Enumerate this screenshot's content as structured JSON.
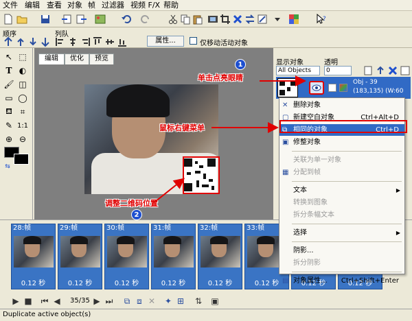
{
  "menu": [
    "文件",
    "编辑",
    "查看",
    "对象",
    "帧",
    "过滤器",
    "视频 F/X",
    "帮助"
  ],
  "toolbar2": {
    "order_label": "顺序",
    "queue_label": "列队",
    "properties_button": "属性...",
    "move_only_active_label": "仅移动活动对象"
  },
  "tabs": [
    "编辑",
    "优化",
    "预览"
  ],
  "objects": {
    "display_label": "显示对象",
    "display_value": "All Objects",
    "opacity_label": "透明",
    "opacity_value": "0",
    "obj_name": "Obj - 39",
    "obj_coords": "(183,135) (W:60"
  },
  "annotations": {
    "click_eye": "单击点亮眼睛",
    "right_click_menu": "鼠标右键菜单",
    "adjust_qr": "调整二维码位置",
    "badge1": "1",
    "badge2": "2"
  },
  "context_menu": [
    {
      "label": "删除对象",
      "shortcut": "",
      "state": "normal"
    },
    {
      "label": "新建空白对象",
      "shortcut": "Ctrl+Alt+D",
      "state": "normal"
    },
    {
      "label": "相同的对象",
      "shortcut": "Ctrl+D",
      "state": "selected"
    },
    {
      "label": "修整对象",
      "shortcut": "",
      "state": "normal"
    },
    {
      "label": "关联为单一对象",
      "shortcut": "",
      "state": "disabled"
    },
    {
      "label": "分配到帧",
      "shortcut": "",
      "state": "disabled"
    },
    {
      "label": "文本",
      "shortcut": "",
      "state": "normal"
    },
    {
      "label": "转换到图象",
      "shortcut": "",
      "state": "disabled"
    },
    {
      "label": "拆分条幅文本",
      "shortcut": "",
      "state": "disabled"
    },
    {
      "label": "选择",
      "shortcut": "",
      "state": "normal"
    },
    {
      "label": "阴影...",
      "shortcut": "",
      "state": "normal"
    },
    {
      "label": "拆分阴影",
      "shortcut": "",
      "state": "disabled"
    },
    {
      "label": "对象属性...",
      "shortcut": "Ctrl+Shift+Enter",
      "state": "normal"
    }
  ],
  "frames": [
    {
      "label": "28:帧",
      "time": "0.12 秒"
    },
    {
      "label": "29:帧",
      "time": "0.12 秒"
    },
    {
      "label": "30:帧",
      "time": "0.12 秒"
    },
    {
      "label": "31:帧",
      "time": "0.12 秒"
    },
    {
      "label": "32:帧",
      "time": "0.12 秒"
    },
    {
      "label": "33:帧",
      "time": "0.12 秒"
    },
    {
      "label": "",
      "time": "0.12 秒"
    },
    {
      "label": "",
      "time": "0.12 秒"
    },
    {
      "label": "",
      "time": "0.12 秒"
    }
  ],
  "playbar": {
    "frame_counter": "35/35"
  },
  "status": "Duplicate active object(s)",
  "colors": {
    "selection": "#316AC5",
    "annotation": "#E00000",
    "frame": "#3A74C4"
  }
}
